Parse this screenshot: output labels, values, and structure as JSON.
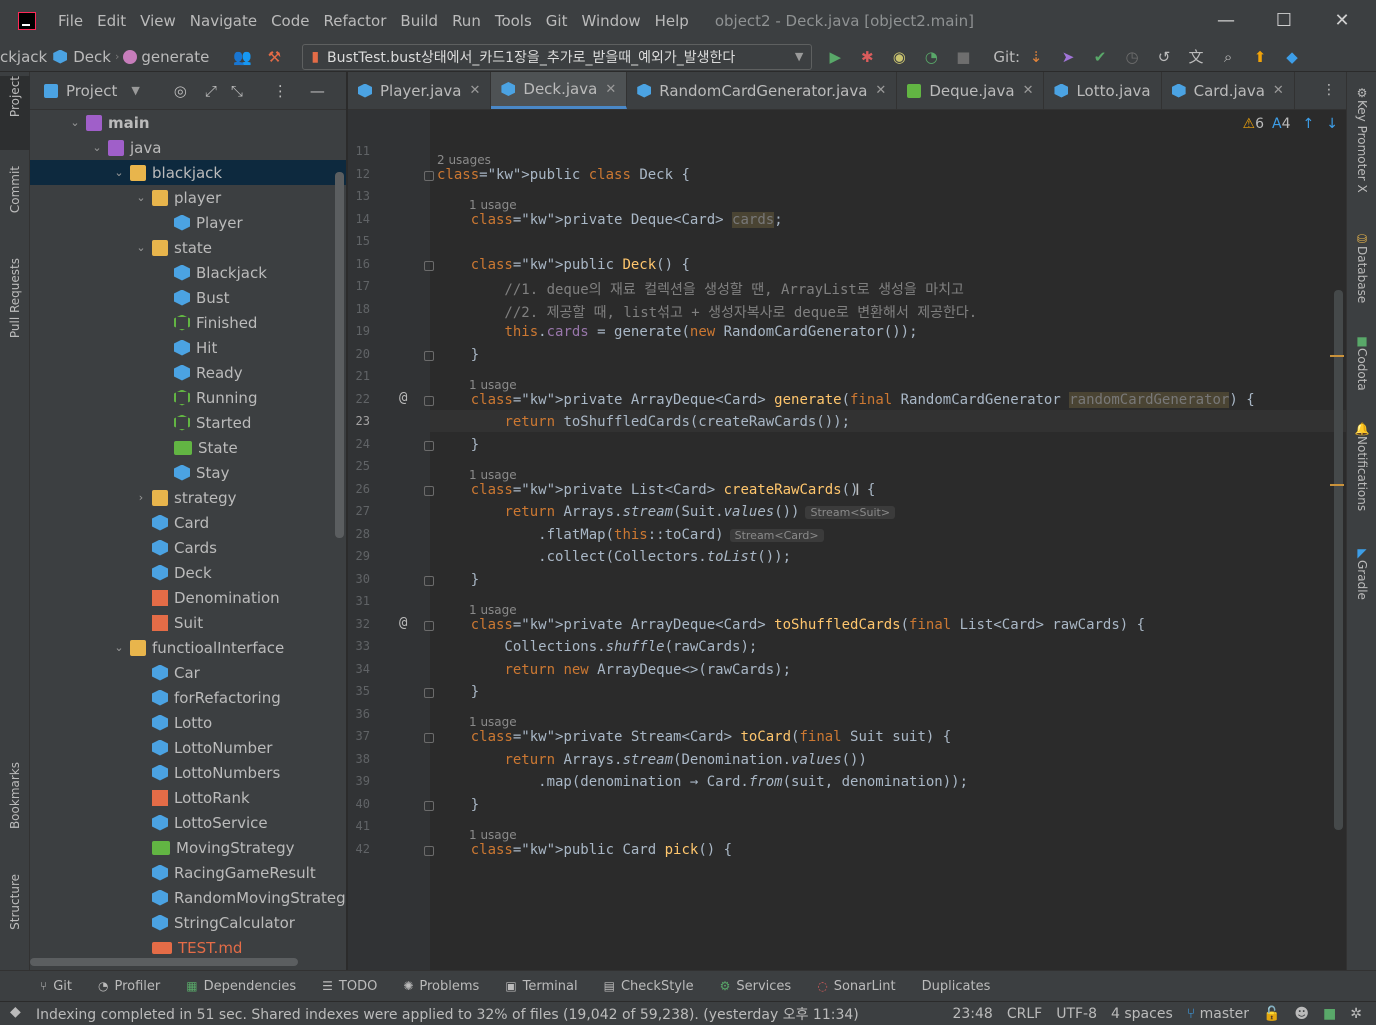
{
  "window": {
    "title": "object2 - Deck.java [object2.main]",
    "controls": {
      "minimize": "—",
      "maximize": "☐",
      "close": "✕"
    }
  },
  "menu": [
    "File",
    "Edit",
    "View",
    "Navigate",
    "Code",
    "Refactor",
    "Build",
    "Run",
    "Tools",
    "Git",
    "Window",
    "Help"
  ],
  "toolbar": {
    "breadcrumbs": [
      "ckjack",
      "Deck",
      "generate"
    ],
    "run_config": "BustTest.bust상태에서_카드1장을_추가로_받을때_예외가_발생한다",
    "git_label": "Git:"
  },
  "left_tool_tabs": [
    "Project",
    "Commit",
    "Pull Requests",
    "Bookmarks",
    "Structure"
  ],
  "right_tool_tabs": [
    "Key Promoter X",
    "Database",
    "Codota",
    "Notifications",
    "Gradle"
  ],
  "project_panel": {
    "title": "Project",
    "tree": [
      {
        "label": "main",
        "depth": 0,
        "icon": "source-folder",
        "expanded": true
      },
      {
        "label": "java",
        "depth": 1,
        "icon": "source-root",
        "expanded": true
      },
      {
        "label": "blackjack",
        "depth": 2,
        "icon": "package",
        "expanded": true,
        "selected": true
      },
      {
        "label": "player",
        "depth": 3,
        "icon": "package",
        "expanded": true
      },
      {
        "label": "Player",
        "depth": 4,
        "icon": "class"
      },
      {
        "label": "state",
        "depth": 3,
        "icon": "package",
        "expanded": true
      },
      {
        "label": "Blackjack",
        "depth": 4,
        "icon": "class"
      },
      {
        "label": "Bust",
        "depth": 4,
        "icon": "class"
      },
      {
        "label": "Finished",
        "depth": 4,
        "icon": "abstract-class"
      },
      {
        "label": "Hit",
        "depth": 4,
        "icon": "class"
      },
      {
        "label": "Ready",
        "depth": 4,
        "icon": "class"
      },
      {
        "label": "Running",
        "depth": 4,
        "icon": "abstract-class"
      },
      {
        "label": "Started",
        "depth": 4,
        "icon": "abstract-class"
      },
      {
        "label": "State",
        "depth": 4,
        "icon": "interface"
      },
      {
        "label": "Stay",
        "depth": 4,
        "icon": "class"
      },
      {
        "label": "strategy",
        "depth": 3,
        "icon": "package",
        "expanded": false
      },
      {
        "label": "Card",
        "depth": 3,
        "icon": "class"
      },
      {
        "label": "Cards",
        "depth": 3,
        "icon": "class"
      },
      {
        "label": "Deck",
        "depth": 3,
        "icon": "class"
      },
      {
        "label": "Denomination",
        "depth": 3,
        "icon": "enum"
      },
      {
        "label": "Suit",
        "depth": 3,
        "icon": "enum"
      },
      {
        "label": "functioalInterface",
        "depth": 2,
        "icon": "package",
        "expanded": true
      },
      {
        "label": "Car",
        "depth": 3,
        "icon": "class"
      },
      {
        "label": "forRefactoring",
        "depth": 3,
        "icon": "class"
      },
      {
        "label": "Lotto",
        "depth": 3,
        "icon": "class"
      },
      {
        "label": "LottoNumber",
        "depth": 3,
        "icon": "class"
      },
      {
        "label": "LottoNumbers",
        "depth": 3,
        "icon": "class"
      },
      {
        "label": "LottoRank",
        "depth": 3,
        "icon": "enum"
      },
      {
        "label": "LottoService",
        "depth": 3,
        "icon": "class"
      },
      {
        "label": "MovingStrategy",
        "depth": 3,
        "icon": "interface"
      },
      {
        "label": "RacingGameResult",
        "depth": 3,
        "icon": "class"
      },
      {
        "label": "RandomMovingStrateg",
        "depth": 3,
        "icon": "class"
      },
      {
        "label": "StringCalculator",
        "depth": 3,
        "icon": "class"
      },
      {
        "label": "TEST.md",
        "depth": 3,
        "icon": "markdown"
      }
    ]
  },
  "editor_tabs": [
    {
      "label": "Player.java",
      "active": false
    },
    {
      "label": "Deck.java",
      "active": true
    },
    {
      "label": "RandomCardGenerator.java",
      "active": false
    },
    {
      "label": "Deque.java",
      "active": false
    },
    {
      "label": "Lotto.java",
      "active": false
    },
    {
      "label": "Card.java",
      "active": false
    }
  ],
  "inspections": {
    "warnings": "6",
    "typos": "4"
  },
  "editor": {
    "current_line": "23",
    "lines": [
      {
        "n": "11",
        "hint": "",
        "code": ""
      },
      {
        "n": "12",
        "hint": "2 usages",
        "code": "public class Deck {"
      },
      {
        "n": "13",
        "hint": "",
        "code": ""
      },
      {
        "n": "14",
        "hint": "1 usage",
        "code": "    private Deque<Card> cards;"
      },
      {
        "n": "15",
        "hint": "",
        "code": ""
      },
      {
        "n": "16",
        "hint": "",
        "code": "    public Deck() {"
      },
      {
        "n": "17",
        "hint": "",
        "code": "        //1. deque의 재료 컬렉션을 생성할 땐, ArrayList로 생성을 마치고"
      },
      {
        "n": "18",
        "hint": "",
        "code": "        //2. 제공할 때, list섞고 + 생성자복사로 deque로 변환해서 제공한다."
      },
      {
        "n": "19",
        "hint": "",
        "code": "        this.cards = generate(new RandomCardGenerator());"
      },
      {
        "n": "20",
        "hint": "",
        "code": "    }"
      },
      {
        "n": "21",
        "hint": "",
        "code": ""
      },
      {
        "n": "22",
        "hint": "1 usage",
        "code": "    private ArrayDeque<Card> generate(final RandomCardGenerator randomCardGenerator) {"
      },
      {
        "n": "23",
        "hint": "",
        "code": "        return toShuffledCards(createRawCards());"
      },
      {
        "n": "24",
        "hint": "",
        "code": "    }"
      },
      {
        "n": "25",
        "hint": "",
        "code": ""
      },
      {
        "n": "26",
        "hint": "1 usage",
        "code": "    private List<Card> createRawCards() {"
      },
      {
        "n": "27",
        "hint": "",
        "code": "        return Arrays.stream(Suit.values())"
      },
      {
        "n": "28",
        "hint": "",
        "code": "            .flatMap(this::toCard)"
      },
      {
        "n": "29",
        "hint": "",
        "code": "            .collect(Collectors.toList());"
      },
      {
        "n": "30",
        "hint": "",
        "code": "    }"
      },
      {
        "n": "31",
        "hint": "",
        "code": ""
      },
      {
        "n": "32",
        "hint": "1 usage",
        "code": "    private ArrayDeque<Card> toShuffledCards(final List<Card> rawCards) {"
      },
      {
        "n": "33",
        "hint": "",
        "code": "        Collections.shuffle(rawCards);"
      },
      {
        "n": "34",
        "hint": "",
        "code": "        return new ArrayDeque<>(rawCards);"
      },
      {
        "n": "35",
        "hint": "",
        "code": "    }"
      },
      {
        "n": "36",
        "hint": "",
        "code": ""
      },
      {
        "n": "37",
        "hint": "1 usage",
        "code": "    private Stream<Card> toCard(final Suit suit) {"
      },
      {
        "n": "38",
        "hint": "",
        "code": "        return Arrays.stream(Denomination.values())"
      },
      {
        "n": "39",
        "hint": "",
        "code": "            .map(denomination → Card.from(suit, denomination));"
      },
      {
        "n": "40",
        "hint": "",
        "code": "    }"
      },
      {
        "n": "41",
        "hint": "",
        "code": ""
      },
      {
        "n": "42",
        "hint": "1 usage",
        "code": "    public Card pick() {"
      }
    ],
    "inline_hints": {
      "line27": "Stream<Suit>",
      "line28": "Stream<Card>"
    },
    "gutter_marks": {
      "line22": "@",
      "line32": "@"
    }
  },
  "bottom_tools": [
    "Git",
    "Profiler",
    "Dependencies",
    "TODO",
    "Problems",
    "Terminal",
    "CheckStyle",
    "Services",
    "SonarLint",
    "Duplicates"
  ],
  "status_bar": {
    "message": "Indexing completed in 51 sec. Shared indexes were applied to 32% of files (19,042 of 59,238). (yesterday 오후 11:34)",
    "position": "23:48",
    "line_sep": "CRLF",
    "encoding": "UTF-8",
    "indent": "4 spaces",
    "branch": "master"
  },
  "colors": {
    "keyword": "#cc7832",
    "method_decl": "#ffc66d",
    "field": "#9876aa",
    "comment": "#808080",
    "text": "#a9b7c6",
    "selection": "#0d293e",
    "accent": "#4a88c7"
  }
}
